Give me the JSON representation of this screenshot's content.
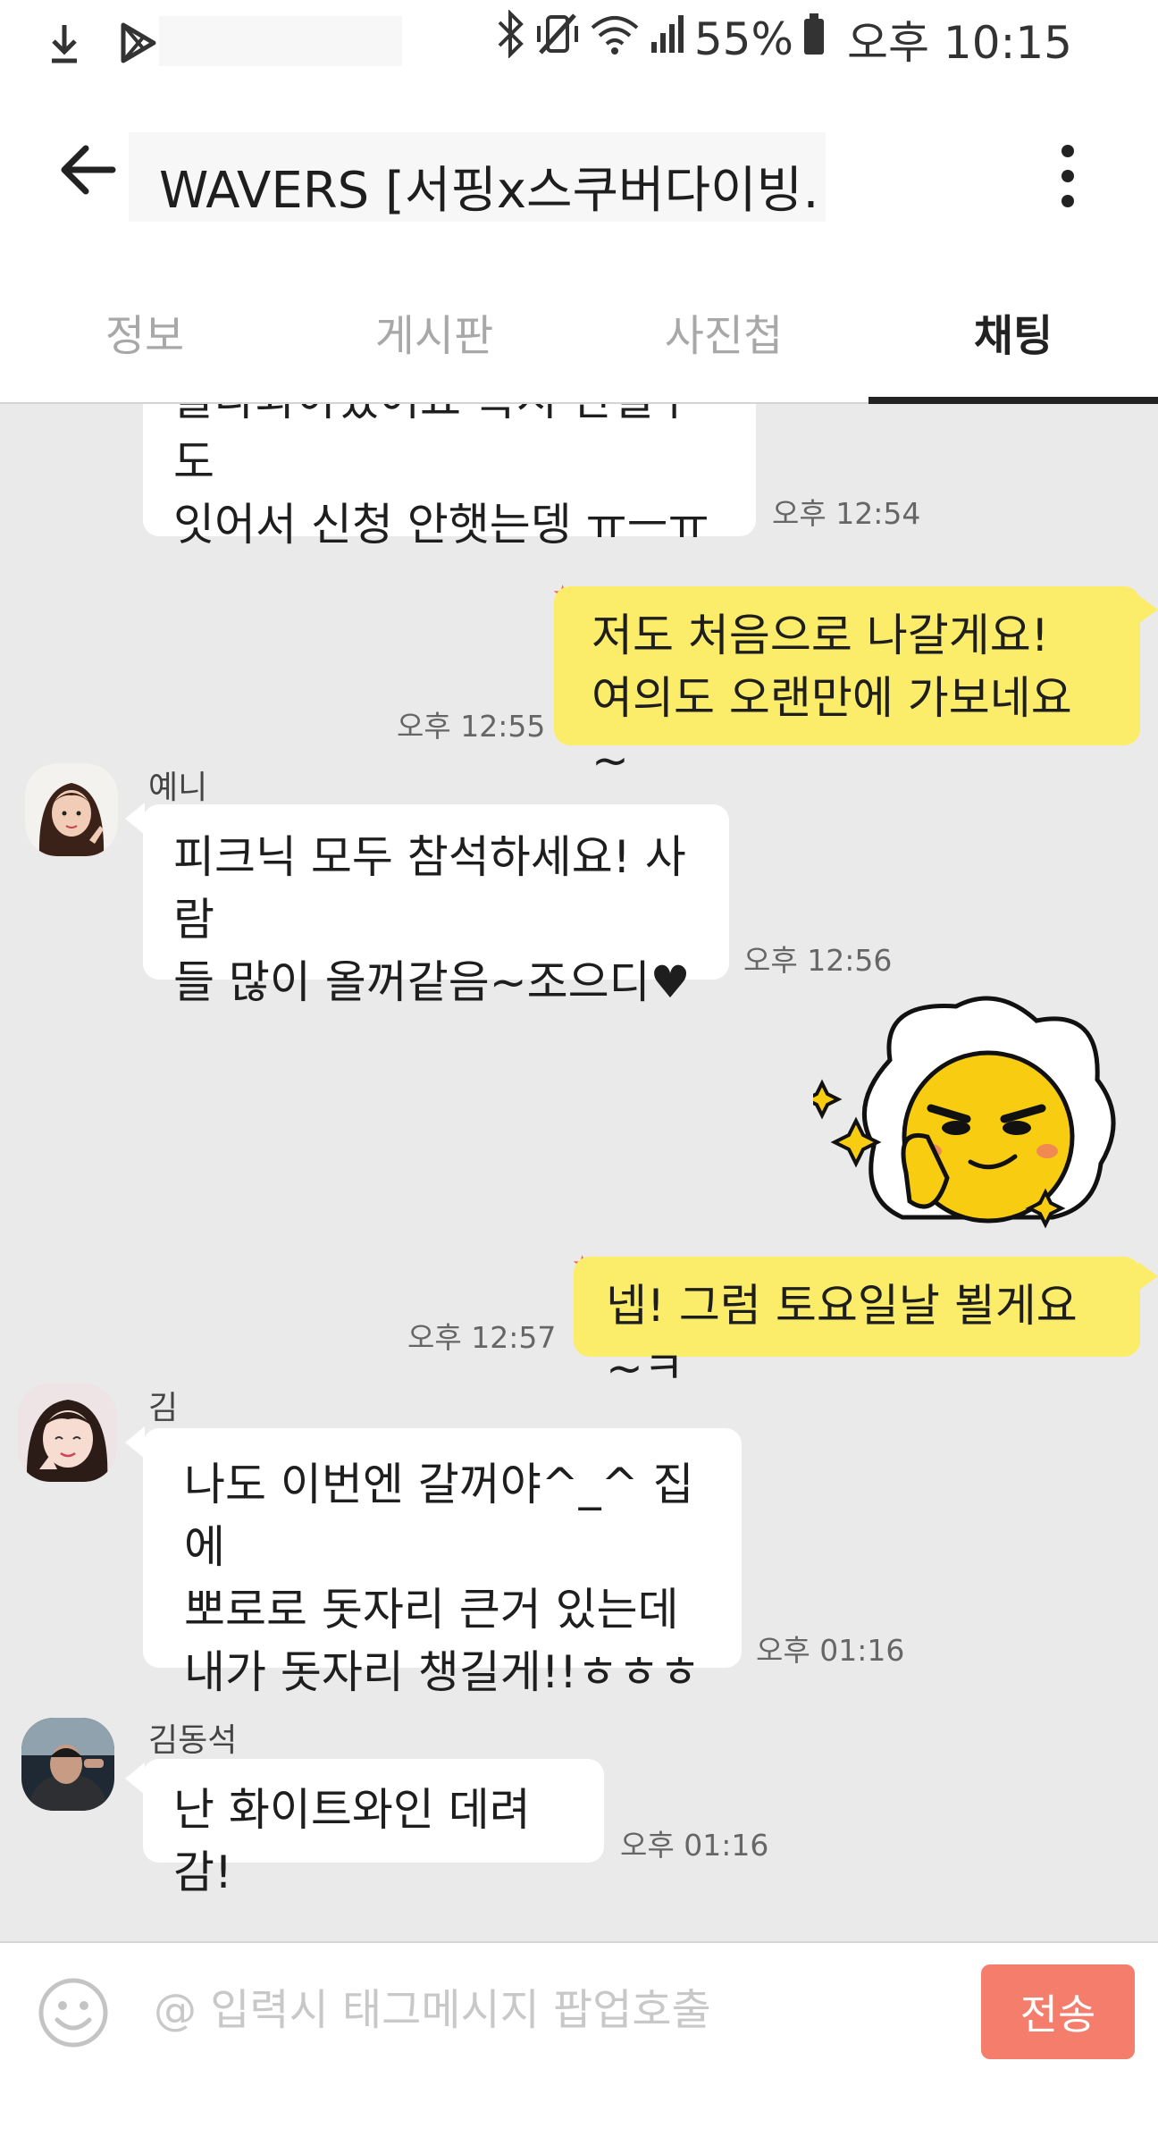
{
  "status_bar": {
    "left_icons": [
      "download-icon",
      "play-store-icon"
    ],
    "right_icons": [
      "bluetooth-icon",
      "vibrate-off-icon",
      "wifi-icon",
      "signal-icon",
      "battery-icon"
    ],
    "battery": "55%",
    "time": "오후 10:15"
  },
  "app_bar": {
    "title": "WAVERS [서핑x스쿠버다이빙…"
  },
  "tabs": [
    {
      "label": "정보",
      "active": false
    },
    {
      "label": "게시판",
      "active": false
    },
    {
      "label": "사진첩",
      "active": false
    },
    {
      "label": "채팅",
      "active": true
    }
  ],
  "messages": [
    {
      "direction": "in",
      "sender": "",
      "text": "올라와야겠어요 혹시 안될수도\n잇어서 신청 안햇는뎅 ㅠㅡㅠ",
      "time": "오후 12:54"
    },
    {
      "direction": "out",
      "text": "저도 처음으로 나갈게요!\n여의도 오랜만에 가보네요~",
      "time": "오후 12:55"
    },
    {
      "direction": "in",
      "sender": "예니",
      "text": "피크닉 모두 참석하세요! 사람\n들 많이 올꺼같음~조으디♥",
      "time": "오후 12:56"
    },
    {
      "direction": "out",
      "type": "sticker",
      "text": ""
    },
    {
      "direction": "out",
      "text": "넵! 그럼 토요일날 뵐게요~ㅋ",
      "time": "오후 12:57"
    },
    {
      "direction": "in",
      "sender": "김",
      "text": "나도 이번엔 갈꺼야^_^ 집에\n뽀로로 돗자리 큰거 있는데\n내가 돗자리 챙길게!!ㅎㅎㅎ",
      "time": "오후 01:16"
    },
    {
      "direction": "in",
      "sender": "김동석",
      "text": "난 화이트와인 데려감!",
      "time": "오후 01:16"
    }
  ],
  "input": {
    "placeholder": "@ 입력시 태그메시지 팝업호출",
    "value": "",
    "send_label": "전송"
  },
  "colors": {
    "outgoing_bubble": "#fbed6a",
    "incoming_bubble": "#ffffff",
    "chat_background": "#eaeaea",
    "send_button": "#f47d6c",
    "unread_star": "#ff5a36"
  }
}
